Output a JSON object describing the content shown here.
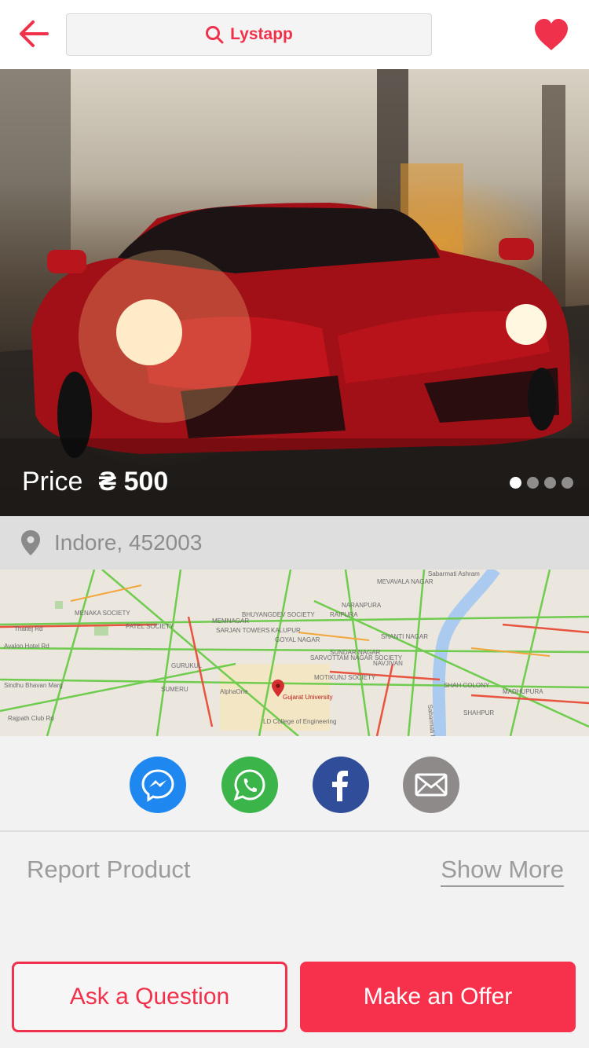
{
  "header": {
    "search_label": "Lystapp",
    "back_icon": "back-arrow-icon",
    "favorite_icon": "heart-icon",
    "accent_color": "#f0314b"
  },
  "product": {
    "price_label": "Price",
    "price_value": "₴ 500",
    "image_count": 4,
    "active_image": 1
  },
  "location": {
    "text": "Indore, 452003",
    "icon": "map-pin-icon"
  },
  "map": {
    "labels": [
      "Sabarmati Ashram",
      "MEVAVALA NAGAR",
      "BHUYANGDEV SOCIETY",
      "NARANPURA",
      "PATEL SOCIETY",
      "SUNDAR NAGAR",
      "SARVOTTAM NAGAR SOCIETY",
      "SHANTI NAGAR",
      "NAVJIVAN",
      "MOTIKUNJ SOCIETY",
      "Gujarat University",
      "AlphaOne",
      "LD College of Engineering",
      "SHAH COLONY",
      "MADHUPURA",
      "SHAHPUR",
      "Sabarmati River",
      "MENAKA SOCIETY",
      "Avalon Hotel Rd",
      "Sindhu Bhavan Marg",
      "Rajpath Club Rd",
      "GURUKUL",
      "SUMERU",
      "Thaltej Rd",
      "MEMNAGAR",
      "SARJAN TOWERS",
      "KALUPUR",
      "GOYAL NAGAR",
      "RAIPURA"
    ]
  },
  "share": {
    "icons": [
      "messenger-icon",
      "whatsapp-icon",
      "facebook-icon",
      "email-icon"
    ],
    "colors": [
      "#1e88f0",
      "#3bb44a",
      "#2f4d99",
      "#8e8a8a"
    ]
  },
  "links": {
    "report": "Report Product",
    "show_more": "Show More"
  },
  "actions": {
    "ask": "Ask a Question",
    "offer": "Make an Offer"
  }
}
